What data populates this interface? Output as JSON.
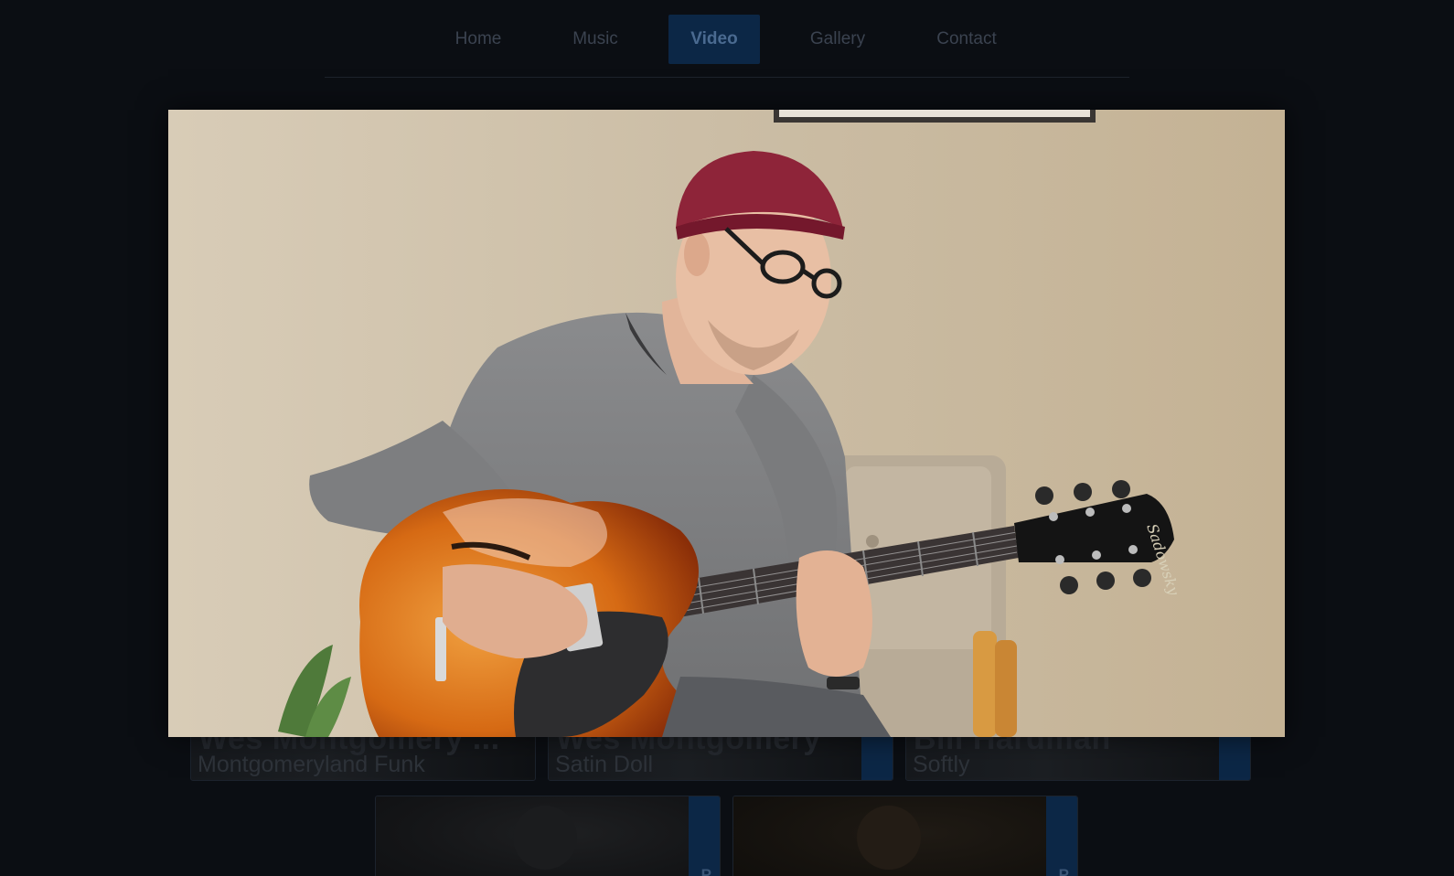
{
  "nav": {
    "items": [
      {
        "label": "Home",
        "active": false
      },
      {
        "label": "Music",
        "active": false
      },
      {
        "label": "Video",
        "active": true
      },
      {
        "label": "Gallery",
        "active": false
      },
      {
        "label": "Contact",
        "active": false
      }
    ]
  },
  "video_cards": [
    {
      "artist": "Wes Montgomery ...",
      "song": "Montgomeryland Funk"
    },
    {
      "artist": "Wes Montgomery",
      "song": "Satin Doll"
    },
    {
      "artist": "Bill Hardman",
      "song": "Softly"
    },
    {
      "tab_letter": "P"
    },
    {
      "tab_letter": "P"
    }
  ],
  "player": {
    "guitar_headstock_text": "Sadowsky"
  },
  "colors": {
    "background": "#0b0e13",
    "nav_active_bg": "#0c2746",
    "card_tab": "#0c2746"
  }
}
